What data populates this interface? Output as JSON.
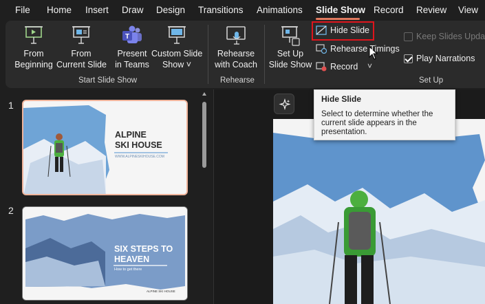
{
  "menu": {
    "tabs": [
      "File",
      "Home",
      "Insert",
      "Draw",
      "Design",
      "Transitions",
      "Animations",
      "Slide Show",
      "Record",
      "Review",
      "View"
    ],
    "active_tab": "Slide Show"
  },
  "ribbon": {
    "start_group": {
      "label": "Start Slide Show",
      "from_beginning": [
        "From",
        "Beginning"
      ],
      "from_current": [
        "From",
        "Current Slide"
      ],
      "present_teams": [
        "Present",
        "in Teams"
      ],
      "custom_show": [
        "Custom Slide",
        "Show ˅"
      ]
    },
    "rehearse_group": {
      "label": "Rehearse",
      "rehearse_coach": [
        "Rehearse",
        "with Coach"
      ]
    },
    "setup_group": {
      "label": "Set Up",
      "setup_show": [
        "Set Up",
        "Slide Show"
      ],
      "hide_slide": "Hide Slide",
      "rehearse_timings": "Rehearse Timings",
      "record": "Record",
      "record_dropdown": "˅",
      "keep_updated": "Keep Slides Updated",
      "play_narrations": "Play Narrations",
      "play_narrations_checked": true,
      "keep_updated_checked": false
    }
  },
  "tooltip": {
    "title": "Hide Slide",
    "body": "Select to determine whether the current slide appears in the presentation."
  },
  "slides": [
    {
      "number": "1",
      "title_line1": "ALPINE",
      "title_line2": "SKI HOUSE",
      "url": "WWW.ALPINESKIHOUSE.COM"
    },
    {
      "number": "2",
      "title_line1": "SIX STEPS TO",
      "title_line2": "HEAVEN",
      "subtitle": "How to get there",
      "footer": "ALPINE SKI HOUSE"
    }
  ],
  "colors": {
    "accent_tab": "#e07a5f",
    "highlight_box": "#e0141c",
    "selected_thumb_border": "#f0b49b",
    "ribbon_bg": "#2b2b2b"
  }
}
